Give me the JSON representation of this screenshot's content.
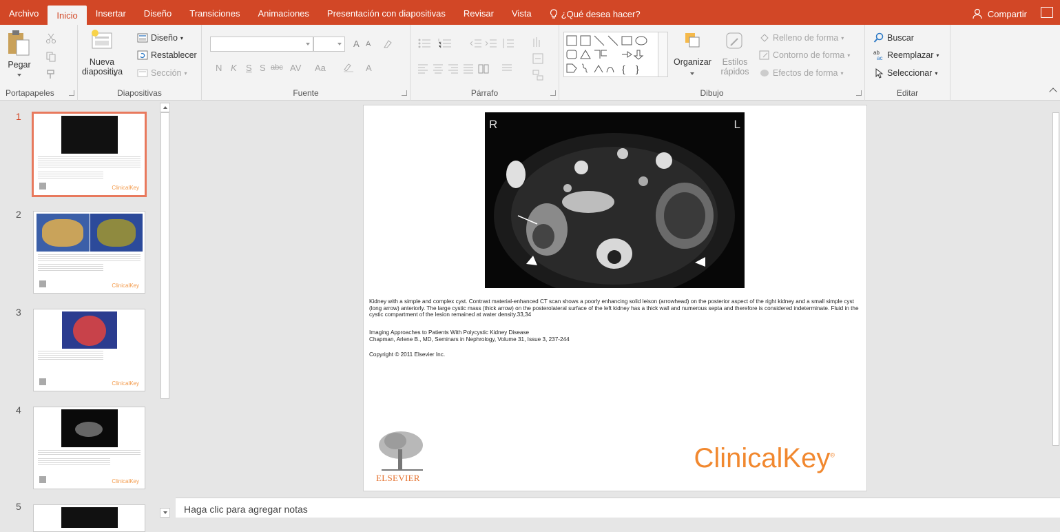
{
  "tabs": [
    {
      "label": "Archivo",
      "active": false
    },
    {
      "label": "Inicio",
      "active": true
    },
    {
      "label": "Insertar",
      "active": false
    },
    {
      "label": "Diseño",
      "active": false
    },
    {
      "label": "Transiciones",
      "active": false
    },
    {
      "label": "Animaciones",
      "active": false
    },
    {
      "label": "Presentación con diapositivas",
      "active": false
    },
    {
      "label": "Revisar",
      "active": false
    },
    {
      "label": "Vista",
      "active": false
    }
  ],
  "tell_me": "¿Qué desea hacer?",
  "share_label": "Compartir",
  "ribbon": {
    "clipboard": {
      "paste": "Pegar",
      "label": "Portapapeles"
    },
    "slides": {
      "new_slide_line1": "Nueva",
      "new_slide_line2": "diapositiva",
      "layout": "Diseño",
      "reset": "Restablecer",
      "section": "Sección",
      "label": "Diapositivas"
    },
    "font": {
      "label": "Fuente",
      "bold": "N",
      "italic": "K",
      "underline": "S",
      "shadow": "S",
      "strike": "abc",
      "spacing": "AV",
      "case": "Aa",
      "color": "A",
      "grow": "A",
      "shrink": "A"
    },
    "paragraph": {
      "label": "Párrafo"
    },
    "drawing": {
      "arrange": "Organizar",
      "quick_styles_line1": "Estilos",
      "quick_styles_line2": "rápidos",
      "fill": "Relleno de forma",
      "outline": "Contorno de forma",
      "effects": "Efectos de forma",
      "label": "Dibujo"
    },
    "editing": {
      "find": "Buscar",
      "replace": "Reemplazar",
      "select": "Seleccionar",
      "label": "Editar"
    }
  },
  "colors": {
    "accent": "#d24726",
    "ribbon_bg": "#f3f3f3",
    "workspace_bg": "#e6e6e6",
    "selected_thumb_border": "#e8795d",
    "clinicalkey_orange": "#f1882f"
  },
  "thumbnails": [
    {
      "number": "1",
      "active": true,
      "brand": "ClinicalKey"
    },
    {
      "number": "2",
      "active": false,
      "brand": "ClinicalKey"
    },
    {
      "number": "3",
      "active": false,
      "brand": "ClinicalKey"
    },
    {
      "number": "4",
      "active": false,
      "brand": "ClinicalKey"
    },
    {
      "number": "5",
      "active": false
    }
  ],
  "slide": {
    "image_labels": {
      "left": "R",
      "right": "L"
    },
    "caption": "Kidney with a simple and complex cyst. Contrast material-enhanced CT scan shows a poorly enhancing solid leison (arrowhead) on the posterior aspect of the right kidney and a small simple cyst (long arrow) anteriorly. The large cystic mass (thick arrow) on the posterolateral surface of the left kidney has a thick wall and numerous septa and therefore is considered indeterminate. Fluid in the cystic compartment of the lesion remained at water density.33,34",
    "article_title": "Imaging Approaches to Patients With Polycystic Kidney Disease",
    "citation": "Chapman, Arlene B., MD, Seminars in Nephrology, Volume 31, Issue 3, 237-244",
    "copyright": "Copyright © 2011 Elsevier Inc.",
    "publisher_logo_text": "ELSEVIER",
    "brand": "ClinicalKey"
  },
  "notes_placeholder": "Haga clic para agregar notas"
}
